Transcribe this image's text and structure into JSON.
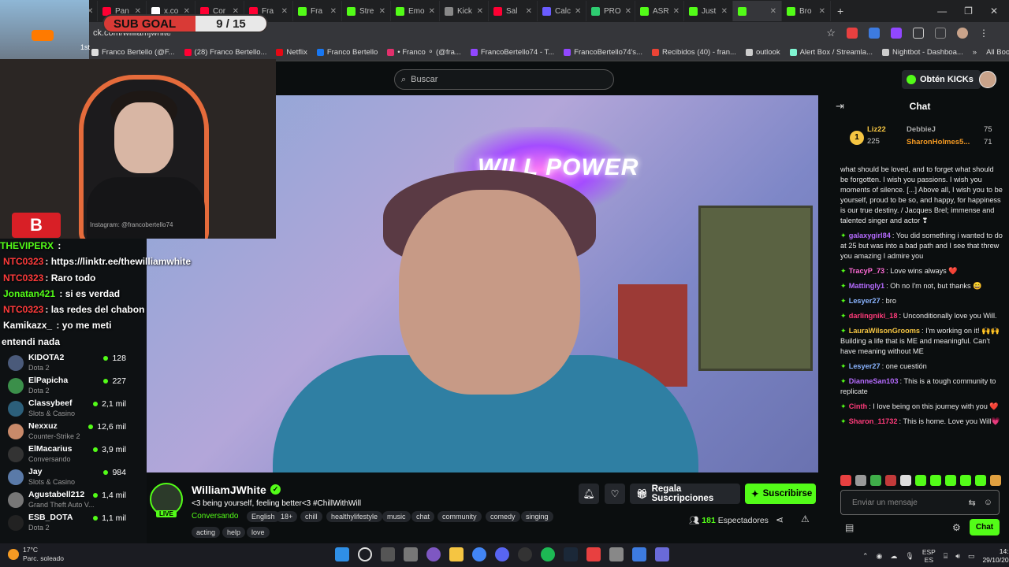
{
  "browser": {
    "tabs": [
      {
        "label": "on",
        "color": "#7b6be0"
      },
      {
        "label": "(3) T",
        "color": "#9147ff"
      },
      {
        "label": "Pan",
        "color": "#ff0033"
      },
      {
        "label": "x.co",
        "color": "#ffffff"
      },
      {
        "label": "Cor",
        "color": "#ff0033"
      },
      {
        "label": "Fra",
        "color": "#ff0033"
      },
      {
        "label": "Fra",
        "color": "#53fc18"
      },
      {
        "label": "Stre",
        "color": "#53fc18"
      },
      {
        "label": "Emo",
        "color": "#53fc18"
      },
      {
        "label": "Kick",
        "color": "#888888"
      },
      {
        "label": "Sal",
        "color": "#ff0033"
      },
      {
        "label": "Calc",
        "color": "#6a5cff"
      },
      {
        "label": "PRO",
        "color": "#2ecc71"
      },
      {
        "label": "ASR",
        "color": "#53fc18"
      },
      {
        "label": "Just",
        "color": "#53fc18"
      },
      {
        "label": "",
        "color": "#53fc18"
      },
      {
        "label": "Bro",
        "color": "#53fc18"
      }
    ],
    "active_tab_index": 15,
    "new_tab": "+",
    "url": "ck.com/williamjwhite",
    "bookmarks": [
      {
        "label": "Franco Bertello (@F...",
        "color": "#dddddd"
      },
      {
        "label": "(28) Franco Bertello...",
        "color": "#ff0033"
      },
      {
        "label": "Netflix",
        "color": "#e50914"
      },
      {
        "label": "Franco Bertello",
        "color": "#1877f2"
      },
      {
        "label": "• Franco ⚬ (@fra...",
        "color": "#e1306c"
      },
      {
        "label": "FrancoBertello74 - T...",
        "color": "#9147ff"
      },
      {
        "label": "FrancoBertello74's...",
        "color": "#9147ff"
      },
      {
        "label": "Recibidos (40) - fran...",
        "color": "#ea4335"
      },
      {
        "label": "outlook",
        "color": "#cccccc"
      },
      {
        "label": "Alert Box / Streamla...",
        "color": "#80f5d2"
      },
      {
        "label": "Nightbot - Dashboa...",
        "color": "#cccccc"
      }
    ],
    "all_bookmarks": "All Bookmarks"
  },
  "overlay": {
    "sub_goal_label": "SUB GOAL",
    "sub_goal_count": "9 / 15",
    "game_tag": "1st",
    "instagram": "Instagram: @francobertello74",
    "chat": [
      {
        "user": "THEVIPERX",
        "text": " :",
        "color": "#53fc18"
      },
      {
        "user": "NTC0323",
        "text": ": https://linktr.ee/thewilliamwhite",
        "color": "#ff3b3b"
      },
      {
        "user": "NTC0323",
        "text": ": Raro todo",
        "color": "#ff3b3b"
      },
      {
        "user": "Jonatan421",
        "text": " : si es verdad",
        "color": "#53fc18"
      },
      {
        "user": "NTC0323",
        "text": ": las redes del chabon",
        "color": "#ff3b3b"
      },
      {
        "user": "Kamikazx_",
        "text": " : yo me meti",
        "color": "#ffffff"
      },
      {
        "user": "",
        "text": "entendi nada",
        "color": "#ffffff"
      }
    ]
  },
  "header": {
    "search_placeholder": "Buscar",
    "kicks_button": "Obtén KICKs"
  },
  "sidebar": {
    "items": [
      {
        "name": "KIDOTA2",
        "category": "Dota 2",
        "viewers": "128",
        "color": "#4a5a7a"
      },
      {
        "name": "ElPapicha",
        "category": "Dota 2",
        "viewers": "227",
        "color": "#3b8f4a"
      },
      {
        "name": "Classybeef",
        "category": "Slots & Casino",
        "viewers": "2,1 mil",
        "color": "#2c5f7a"
      },
      {
        "name": "Nexxuz",
        "category": "Counter-Strike 2",
        "viewers": "12,6 mil",
        "color": "#c98a6a"
      },
      {
        "name": "ElMacarius",
        "category": "Conversando",
        "viewers": "3,9 mil",
        "color": "#333333"
      },
      {
        "name": "Jay",
        "category": "Slots & Casino",
        "viewers": "984",
        "color": "#5a7aa8"
      },
      {
        "name": "Agustabell212",
        "category": "Grand Theft Auto V...",
        "viewers": "1,4 mil",
        "color": "#777777"
      },
      {
        "name": "ESB_DOTA",
        "category": "Dota 2",
        "viewers": "1,1 mil",
        "color": "#222222"
      }
    ]
  },
  "stream": {
    "channel": "WilliamJWhite",
    "title": "<3 being yourself, feeling better<3 #ChillWithWill",
    "category": "Conversando",
    "live_badge": "LIVE",
    "tags_row1": [
      "English",
      "18+",
      "chill",
      "healthylifestyle",
      "music",
      "chat",
      "community",
      "comedy",
      "singing"
    ],
    "tags_row2": [
      "acting",
      "help",
      "love"
    ],
    "gift_button": "Regala Suscripciones",
    "subscribe_button": "Suscribirse",
    "viewers_count": "181",
    "viewers_label": "Espectadores",
    "neon_sign": "WILL POWER"
  },
  "chat": {
    "title": "Chat",
    "leaderboard": [
      {
        "user": "Liz22",
        "score": "225",
        "color": "#f5c542"
      },
      {
        "user": "DebbieJ",
        "score": "75",
        "color": "#aaaaaa"
      },
      {
        "user": "SharonHolmes5...",
        "score": "71",
        "color": "#f59a23"
      }
    ],
    "leaderboard_rank": "1",
    "messages": [
      {
        "user": "",
        "color": "#ffffff",
        "text": "what should be loved, and to forget what should be forgotten. I wish you passions. I wish you moments of silence. [...] Above all, I wish you to be yourself, proud to be so, and happy, for happiness is our true destiny. / Jacques Brel; immense and talented singer and actor ❣"
      },
      {
        "user": "galaxygirl84",
        "color": "#b66bff",
        "text": "You did something i wanted to do at 25 but was into a bad path and I see that threw you amazing I admire you"
      },
      {
        "user": "TracyP_73",
        "color": "#ff6bd6",
        "text": "Love wins always ❤️"
      },
      {
        "user": "Mattingly1",
        "color": "#b66bff",
        "text": "Oh no I'm not, but thanks 😄"
      },
      {
        "user": "Lesyer27",
        "color": "#8ab4ff",
        "text": "bro"
      },
      {
        "user": "darlingniki_18",
        "color": "#ff3b7a",
        "text": "Unconditionally love you Will."
      },
      {
        "user": "LauraWilsonGrooms",
        "color": "#f5c542",
        "text": "I'm working on it! 🙌🙌 Building a life that is ME and meaningful. Can't have meaning without ME"
      },
      {
        "user": "Lesyer27",
        "color": "#8ab4ff",
        "text": "one cuestión"
      },
      {
        "user": "DianneSan103",
        "color": "#b66bff",
        "text": "This is a tough community to replicate"
      },
      {
        "user": "Cinth",
        "color": "#ff3b7a",
        "text": "I love being on this journey with you ❤️"
      },
      {
        "user": "Sharon_11732",
        "color": "#ff3b7a",
        "text": "This is home. Love you Will💗"
      }
    ],
    "input_placeholder": "Enviar un mensaje",
    "send_button": "Chat"
  },
  "taskbar": {
    "temp": "17°C",
    "weather": "Parc. soleado",
    "lang_top": "ESP",
    "lang_bottom": "ES",
    "time": "14:23",
    "date": "29/10/2025"
  }
}
